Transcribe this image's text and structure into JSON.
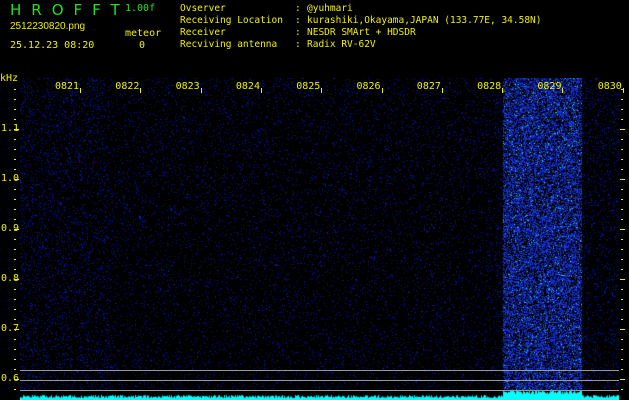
{
  "header": {
    "app_title": "HROFFT",
    "version": "1.00f",
    "filename": "2512230820.png",
    "datetime": "25.12.23 08:20",
    "meteor_label": "meteor",
    "meteor_count": "0",
    "info": [
      {
        "label": "Ovserver",
        "value": "@yuhmari"
      },
      {
        "label": "Receiving Location",
        "value": "kurashiki,Okayama,JAPAN (133.77E, 34.58N)"
      },
      {
        "label": "Receiver",
        "value": "NESDR SMArt + HDSDR"
      },
      {
        "label": "Recviving antenna",
        "value": "Radix RV-62V"
      }
    ]
  },
  "axis": {
    "unit": "kHz",
    "time_labels": [
      "0821",
      "0822",
      "0823",
      "0824",
      "0825",
      "0826",
      "0827",
      "0828",
      "0829",
      "0830"
    ],
    "freq_labels": [
      "1.1",
      "1.0",
      "0.9",
      "0.8",
      "0.7",
      "0.6"
    ]
  },
  "colors": {
    "text": "#f0f000",
    "title": "#20e020",
    "noise": "#1a2acc",
    "signal": "#00ffff"
  }
}
